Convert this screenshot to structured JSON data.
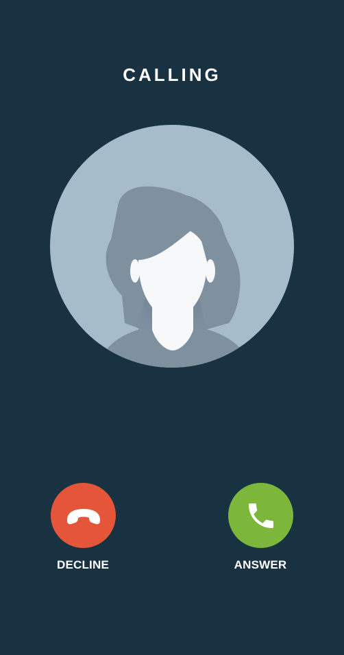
{
  "call": {
    "status": "CALLING"
  },
  "caller": {
    "avatar_icon": "female-user-placeholder-icon"
  },
  "actions": {
    "decline": {
      "label": "DECLINE",
      "icon": "phone-hangup-icon",
      "color": "#e4553a"
    },
    "answer": {
      "label": "ANSWER",
      "icon": "phone-icon",
      "color": "#7cb73c"
    }
  },
  "theme": {
    "background": "#183241",
    "avatar_background": "#a7bccb",
    "avatar_hair": "#7f909f",
    "avatar_skin": "#f6f8fa"
  }
}
